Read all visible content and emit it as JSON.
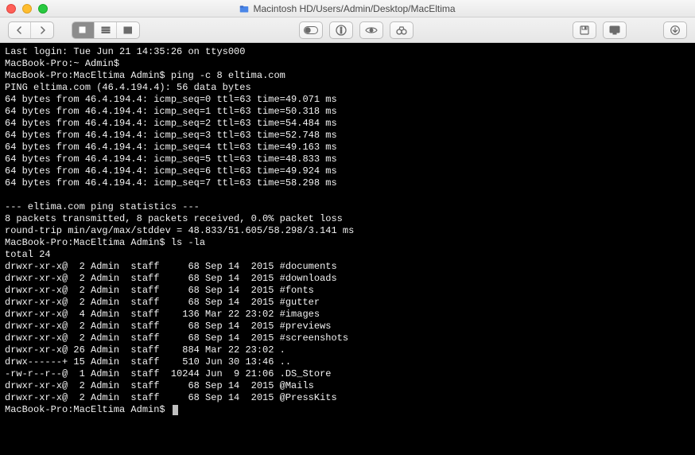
{
  "window": {
    "title": "Macintosh HD/Users/Admin/Desktop/MacEltima",
    "icon_color_a": "#3b82f6",
    "icon_color_b": "#1e40af"
  },
  "terminal": {
    "last_login": "Last login: Tue Jun 21 14:35:26 on ttys000",
    "prompt1": "MacBook-Pro:~ Admin$",
    "prompt2": "MacBook-Pro:MacEltima Admin$",
    "cmd_ping": "ping -c 8 eltima.com",
    "ping_header": "PING eltima.com (46.4.194.4): 56 data bytes",
    "ping_lines": [
      "64 bytes from 46.4.194.4: icmp_seq=0 ttl=63 time=49.071 ms",
      "64 bytes from 46.4.194.4: icmp_seq=1 ttl=63 time=50.318 ms",
      "64 bytes from 46.4.194.4: icmp_seq=2 ttl=63 time=54.484 ms",
      "64 bytes from 46.4.194.4: icmp_seq=3 ttl=63 time=52.748 ms",
      "64 bytes from 46.4.194.4: icmp_seq=4 ttl=63 time=49.163 ms",
      "64 bytes from 46.4.194.4: icmp_seq=5 ttl=63 time=48.833 ms",
      "64 bytes from 46.4.194.4: icmp_seq=6 ttl=63 time=49.924 ms",
      "64 bytes from 46.4.194.4: icmp_seq=7 ttl=63 time=58.298 ms"
    ],
    "stats_sep": "--- eltima.com ping statistics ---",
    "stats_1": "8 packets transmitted, 8 packets received, 0.0% packet loss",
    "stats_2": "round-trip min/avg/max/stddev = 48.833/51.605/58.298/3.141 ms",
    "cmd_ls": "ls -la",
    "total": "total 24",
    "rows": [
      "drwxr-xr-x@  2 Admin  staff     68 Sep 14  2015 #documents",
      "drwxr-xr-x@  2 Admin  staff     68 Sep 14  2015 #downloads",
      "drwxr-xr-x@  2 Admin  staff     68 Sep 14  2015 #fonts",
      "drwxr-xr-x@  2 Admin  staff     68 Sep 14  2015 #gutter",
      "drwxr-xr-x@  4 Admin  staff    136 Mar 22 23:02 #images",
      "drwxr-xr-x@  2 Admin  staff     68 Sep 14  2015 #previews",
      "drwxr-xr-x@  2 Admin  staff     68 Sep 14  2015 #screenshots",
      "drwxr-xr-x@ 26 Admin  staff    884 Mar 22 23:02 .",
      "drwx------+ 15 Admin  staff    510 Jun 30 13:46 ..",
      "-rw-r--r--@  1 Admin  staff  10244 Jun  9 21:06 .DS_Store",
      "drwxr-xr-x@  2 Admin  staff     68 Sep 14  2015 @Mails",
      "drwxr-xr-x@  2 Admin  staff     68 Sep 14  2015 @PressKits"
    ]
  }
}
